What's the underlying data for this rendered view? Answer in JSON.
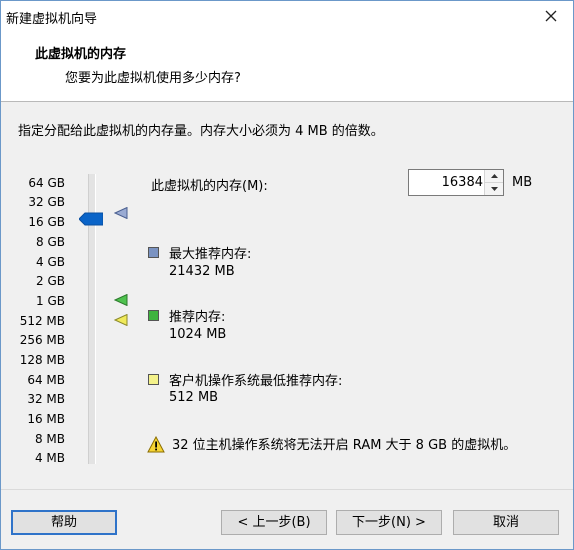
{
  "window": {
    "title": "新建虚拟机向导"
  },
  "header": {
    "title": "此虚拟机的内存",
    "subtitle": "您要为此虚拟机使用多少内存?"
  },
  "instruction": "指定分配给此虚拟机的内存量。内存大小必须为 4 MB 的倍数。",
  "scale_labels": [
    "64 GB",
    "32 GB",
    "16 GB",
    "8 GB",
    "4 GB",
    "2 GB",
    "1 GB",
    "512 MB",
    "256 MB",
    "128 MB",
    "64 MB",
    "32 MB",
    "16 MB",
    "8 MB",
    "4 MB"
  ],
  "memory": {
    "label": "此虚拟机的内存(M):",
    "value": "16384",
    "unit": "MB"
  },
  "legend": [
    {
      "title": "最大推荐内存:",
      "value": "21432 MB",
      "color": "#7b93c2"
    },
    {
      "title": "推荐内存:",
      "value": "1024 MB",
      "color": "#3fb33f"
    },
    {
      "title": "客户机操作系统最低推荐内存:",
      "value": "512 MB",
      "color": "#f4f28a"
    }
  ],
  "warning": "32 位主机操作系统将无法开启 RAM 大于 8 GB 的虚拟机。",
  "buttons": {
    "help": "帮助",
    "back": "< 上一步(B)",
    "next": "下一步(N) >",
    "cancel": "取消"
  },
  "colors": {
    "accent": "#0a64c8",
    "default_border": "#2f73c9"
  },
  "icons": {
    "close": "close-icon",
    "warning": "warning-icon"
  }
}
